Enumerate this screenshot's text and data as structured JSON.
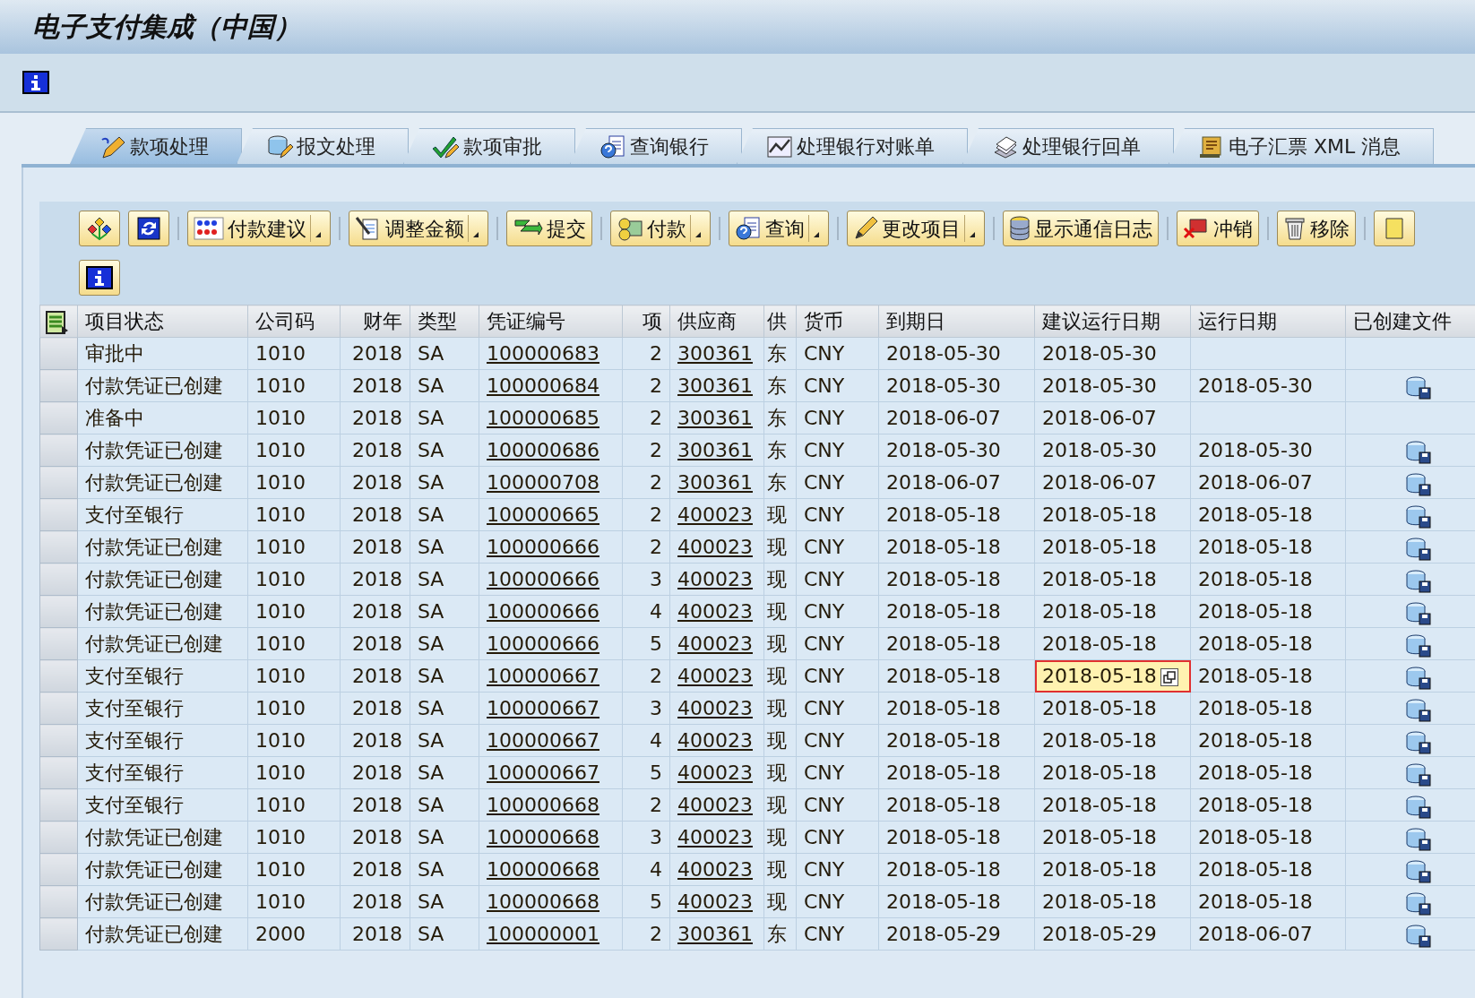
{
  "window": {
    "title": "电子支付集成（中国）"
  },
  "tabs": [
    {
      "label": "款项处理",
      "selected": true
    },
    {
      "label": "报文处理",
      "selected": false
    },
    {
      "label": "款项审批",
      "selected": false
    },
    {
      "label": "查询银行",
      "selected": false
    },
    {
      "label": "处理银行对账单",
      "selected": false
    },
    {
      "label": "处理银行回单",
      "selected": false
    },
    {
      "label": "电子汇票 XML 消息",
      "selected": false
    }
  ],
  "toolbar": [
    {
      "kind": "icon",
      "dropdown": false
    },
    {
      "kind": "icon",
      "dropdown": false
    },
    {
      "kind": "text",
      "label": "付款建议",
      "dropdown": true
    },
    {
      "kind": "text",
      "label": "调整金额",
      "dropdown": true
    },
    {
      "kind": "text",
      "label": "提交",
      "dropdown": false
    },
    {
      "kind": "text",
      "label": "付款",
      "dropdown": true
    },
    {
      "kind": "text",
      "label": "查询",
      "dropdown": true
    },
    {
      "kind": "text",
      "label": "更改项目",
      "dropdown": true
    },
    {
      "kind": "text",
      "label": "显示通信日志",
      "dropdown": false
    },
    {
      "kind": "text",
      "label": "冲销",
      "dropdown": false
    },
    {
      "kind": "text",
      "label": "移除",
      "dropdown": false
    },
    {
      "kind": "icon",
      "dropdown": false
    }
  ],
  "table": {
    "columns": [
      "项目状态",
      "公司码",
      "财年",
      "类型",
      "凭证编号",
      "项",
      "供应商",
      "供",
      "货币",
      "到期日",
      "建议运行日期",
      "运行日期",
      "已创建文件"
    ],
    "rows": [
      {
        "status": "审批中",
        "company": "1010",
        "year": "2018",
        "type": "SA",
        "document": "100000683",
        "item": "2",
        "vendor": "300361",
        "vendor_short": "东",
        "currency": "CNY",
        "due_date": "2018-05-30",
        "proposed_date": "2018-05-30",
        "focused": false,
        "file_created": false
      },
      {
        "status": "付款凭证已创建",
        "company": "1010",
        "year": "2018",
        "type": "SA",
        "document": "100000684",
        "item": "2",
        "vendor": "300361",
        "vendor_short": "东",
        "currency": "CNY",
        "due_date": "2018-05-30",
        "proposed_date": "2018-05-30",
        "run_date": "2018-05-30",
        "focused": false,
        "file_created": true
      },
      {
        "status": "准备中",
        "company": "1010",
        "year": "2018",
        "type": "SA",
        "document": "100000685",
        "item": "2",
        "vendor": "300361",
        "vendor_short": "东",
        "currency": "CNY",
        "due_date": "2018-06-07",
        "proposed_date": "2018-06-07",
        "focused": false,
        "file_created": false
      },
      {
        "status": "付款凭证已创建",
        "company": "1010",
        "year": "2018",
        "type": "SA",
        "document": "100000686",
        "item": "2",
        "vendor": "300361",
        "vendor_short": "东",
        "currency": "CNY",
        "due_date": "2018-05-30",
        "proposed_date": "2018-05-30",
        "run_date": "2018-05-30",
        "focused": false,
        "file_created": true
      },
      {
        "status": "付款凭证已创建",
        "company": "1010",
        "year": "2018",
        "type": "SA",
        "document": "100000708",
        "item": "2",
        "vendor": "300361",
        "vendor_short": "东",
        "currency": "CNY",
        "due_date": "2018-06-07",
        "proposed_date": "2018-06-07",
        "run_date": "2018-06-07",
        "focused": false,
        "file_created": true
      },
      {
        "status": "支付至银行",
        "company": "1010",
        "year": "2018",
        "type": "SA",
        "document": "100000665",
        "item": "2",
        "vendor": "400023",
        "vendor_short": "现",
        "currency": "CNY",
        "due_date": "2018-05-18",
        "proposed_date": "2018-05-18",
        "run_date": "2018-05-18",
        "focused": false,
        "file_created": true
      },
      {
        "status": "付款凭证已创建",
        "company": "1010",
        "year": "2018",
        "type": "SA",
        "document": "100000666",
        "item": "2",
        "vendor": "400023",
        "vendor_short": "现",
        "currency": "CNY",
        "due_date": "2018-05-18",
        "proposed_date": "2018-05-18",
        "run_date": "2018-05-18",
        "focused": false,
        "file_created": true
      },
      {
        "status": "付款凭证已创建",
        "company": "1010",
        "year": "2018",
        "type": "SA",
        "document": "100000666",
        "item": "3",
        "vendor": "400023",
        "vendor_short": "现",
        "currency": "CNY",
        "due_date": "2018-05-18",
        "proposed_date": "2018-05-18",
        "run_date": "2018-05-18",
        "focused": false,
        "file_created": true
      },
      {
        "status": "付款凭证已创建",
        "company": "1010",
        "year": "2018",
        "type": "SA",
        "document": "100000666",
        "item": "4",
        "vendor": "400023",
        "vendor_short": "现",
        "currency": "CNY",
        "due_date": "2018-05-18",
        "proposed_date": "2018-05-18",
        "run_date": "2018-05-18",
        "focused": false,
        "file_created": true
      },
      {
        "status": "付款凭证已创建",
        "company": "1010",
        "year": "2018",
        "type": "SA",
        "document": "100000666",
        "item": "5",
        "vendor": "400023",
        "vendor_short": "现",
        "currency": "CNY",
        "due_date": "2018-05-18",
        "proposed_date": "2018-05-18",
        "run_date": "2018-05-18",
        "focused": false,
        "file_created": true
      },
      {
        "status": "支付至银行",
        "company": "1010",
        "year": "2018",
        "type": "SA",
        "document": "100000667",
        "item": "2",
        "vendor": "400023",
        "vendor_short": "现",
        "currency": "CNY",
        "due_date": "2018-05-18",
        "proposed_date": "2018-05-18",
        "run_date": "2018-05-18",
        "focused": true,
        "file_created": true
      },
      {
        "status": "支付至银行",
        "company": "1010",
        "year": "2018",
        "type": "SA",
        "document": "100000667",
        "item": "3",
        "vendor": "400023",
        "vendor_short": "现",
        "currency": "CNY",
        "due_date": "2018-05-18",
        "proposed_date": "2018-05-18",
        "run_date": "2018-05-18",
        "focused": false,
        "file_created": true
      },
      {
        "status": "支付至银行",
        "company": "1010",
        "year": "2018",
        "type": "SA",
        "document": "100000667",
        "item": "4",
        "vendor": "400023",
        "vendor_short": "现",
        "currency": "CNY",
        "due_date": "2018-05-18",
        "proposed_date": "2018-05-18",
        "run_date": "2018-05-18",
        "focused": false,
        "file_created": true
      },
      {
        "status": "支付至银行",
        "company": "1010",
        "year": "2018",
        "type": "SA",
        "document": "100000667",
        "item": "5",
        "vendor": "400023",
        "vendor_short": "现",
        "currency": "CNY",
        "due_date": "2018-05-18",
        "proposed_date": "2018-05-18",
        "run_date": "2018-05-18",
        "focused": false,
        "file_created": true
      },
      {
        "status": "支付至银行",
        "company": "1010",
        "year": "2018",
        "type": "SA",
        "document": "100000668",
        "item": "2",
        "vendor": "400023",
        "vendor_short": "现",
        "currency": "CNY",
        "due_date": "2018-05-18",
        "proposed_date": "2018-05-18",
        "run_date": "2018-05-18",
        "focused": false,
        "file_created": true
      },
      {
        "status": "付款凭证已创建",
        "company": "1010",
        "year": "2018",
        "type": "SA",
        "document": "100000668",
        "item": "3",
        "vendor": "400023",
        "vendor_short": "现",
        "currency": "CNY",
        "due_date": "2018-05-18",
        "proposed_date": "2018-05-18",
        "run_date": "2018-05-18",
        "focused": false,
        "file_created": true
      },
      {
        "status": "付款凭证已创建",
        "company": "1010",
        "year": "2018",
        "type": "SA",
        "document": "100000668",
        "item": "4",
        "vendor": "400023",
        "vendor_short": "现",
        "currency": "CNY",
        "due_date": "2018-05-18",
        "proposed_date": "2018-05-18",
        "run_date": "2018-05-18",
        "focused": false,
        "file_created": true
      },
      {
        "status": "付款凭证已创建",
        "company": "1010",
        "year": "2018",
        "type": "SA",
        "document": "100000668",
        "item": "5",
        "vendor": "400023",
        "vendor_short": "现",
        "currency": "CNY",
        "due_date": "2018-05-18",
        "proposed_date": "2018-05-18",
        "run_date": "2018-05-18",
        "focused": false,
        "file_created": true
      },
      {
        "status": "付款凭证已创建",
        "company": "2000",
        "year": "2018",
        "type": "SA",
        "document": "100000001",
        "item": "2",
        "vendor": "300361",
        "vendor_short": "东",
        "currency": "CNY",
        "due_date": "2018-05-29",
        "proposed_date": "2018-05-29",
        "run_date": "2018-06-07",
        "focused": false,
        "file_created": true
      }
    ]
  }
}
